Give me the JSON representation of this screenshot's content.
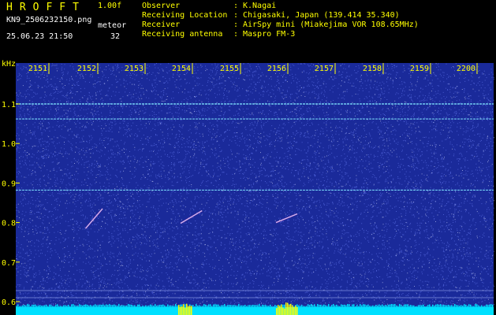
{
  "header": {
    "logo": "HROFFT",
    "version": "1.00f",
    "filename": "KN9_2506232150.png",
    "meteor_label": "meteor",
    "datetime": "25.06.23 21:50",
    "meteor_count": "32",
    "meta": [
      {
        "label": "Observer",
        "value": "K.Nagai"
      },
      {
        "label": "Receiving Location",
        "value": "Chigasaki, Japan (139.414 35.340)"
      },
      {
        "label": "Receiver",
        "value": "AirSpy mini (Miakejima VOR 108.65MHz)"
      },
      {
        "label": "Receiving antenna",
        "value": "Maspro FM-3"
      }
    ],
    "colon": ":"
  },
  "axis": {
    "unit": "kHz",
    "x_ticks": [
      "2151",
      "2152",
      "2153",
      "2154",
      "2155",
      "2156",
      "2157",
      "2158",
      "2159",
      "2200"
    ],
    "y_ticks": [
      "1.1",
      "1.0",
      "0.9",
      "0.8",
      "0.7",
      "0.6"
    ],
    "y_values": [
      1.1,
      1.0,
      0.9,
      0.8,
      0.7,
      0.6
    ]
  },
  "colors": {
    "background": "#1a2a9a",
    "noise": "#6f84ff",
    "carrier": "#7fe6ff",
    "meteor": "#ff5ad0",
    "activity": "#00e0ff",
    "burst": "#ffff00"
  },
  "traces": {
    "horizontal_lines_khz": [
      1.1,
      1.062,
      0.882
    ],
    "meteors": [
      {
        "x_start": 2151.75,
        "y_start": 0.785,
        "x_end": 2152.1,
        "y_end": 0.835
      },
      {
        "x_start": 2153.75,
        "y_start": 0.798,
        "x_end": 2154.2,
        "y_end": 0.83
      },
      {
        "x_start": 2155.75,
        "y_start": 0.8,
        "x_end": 2156.2,
        "y_end": 0.822
      }
    ]
  }
}
